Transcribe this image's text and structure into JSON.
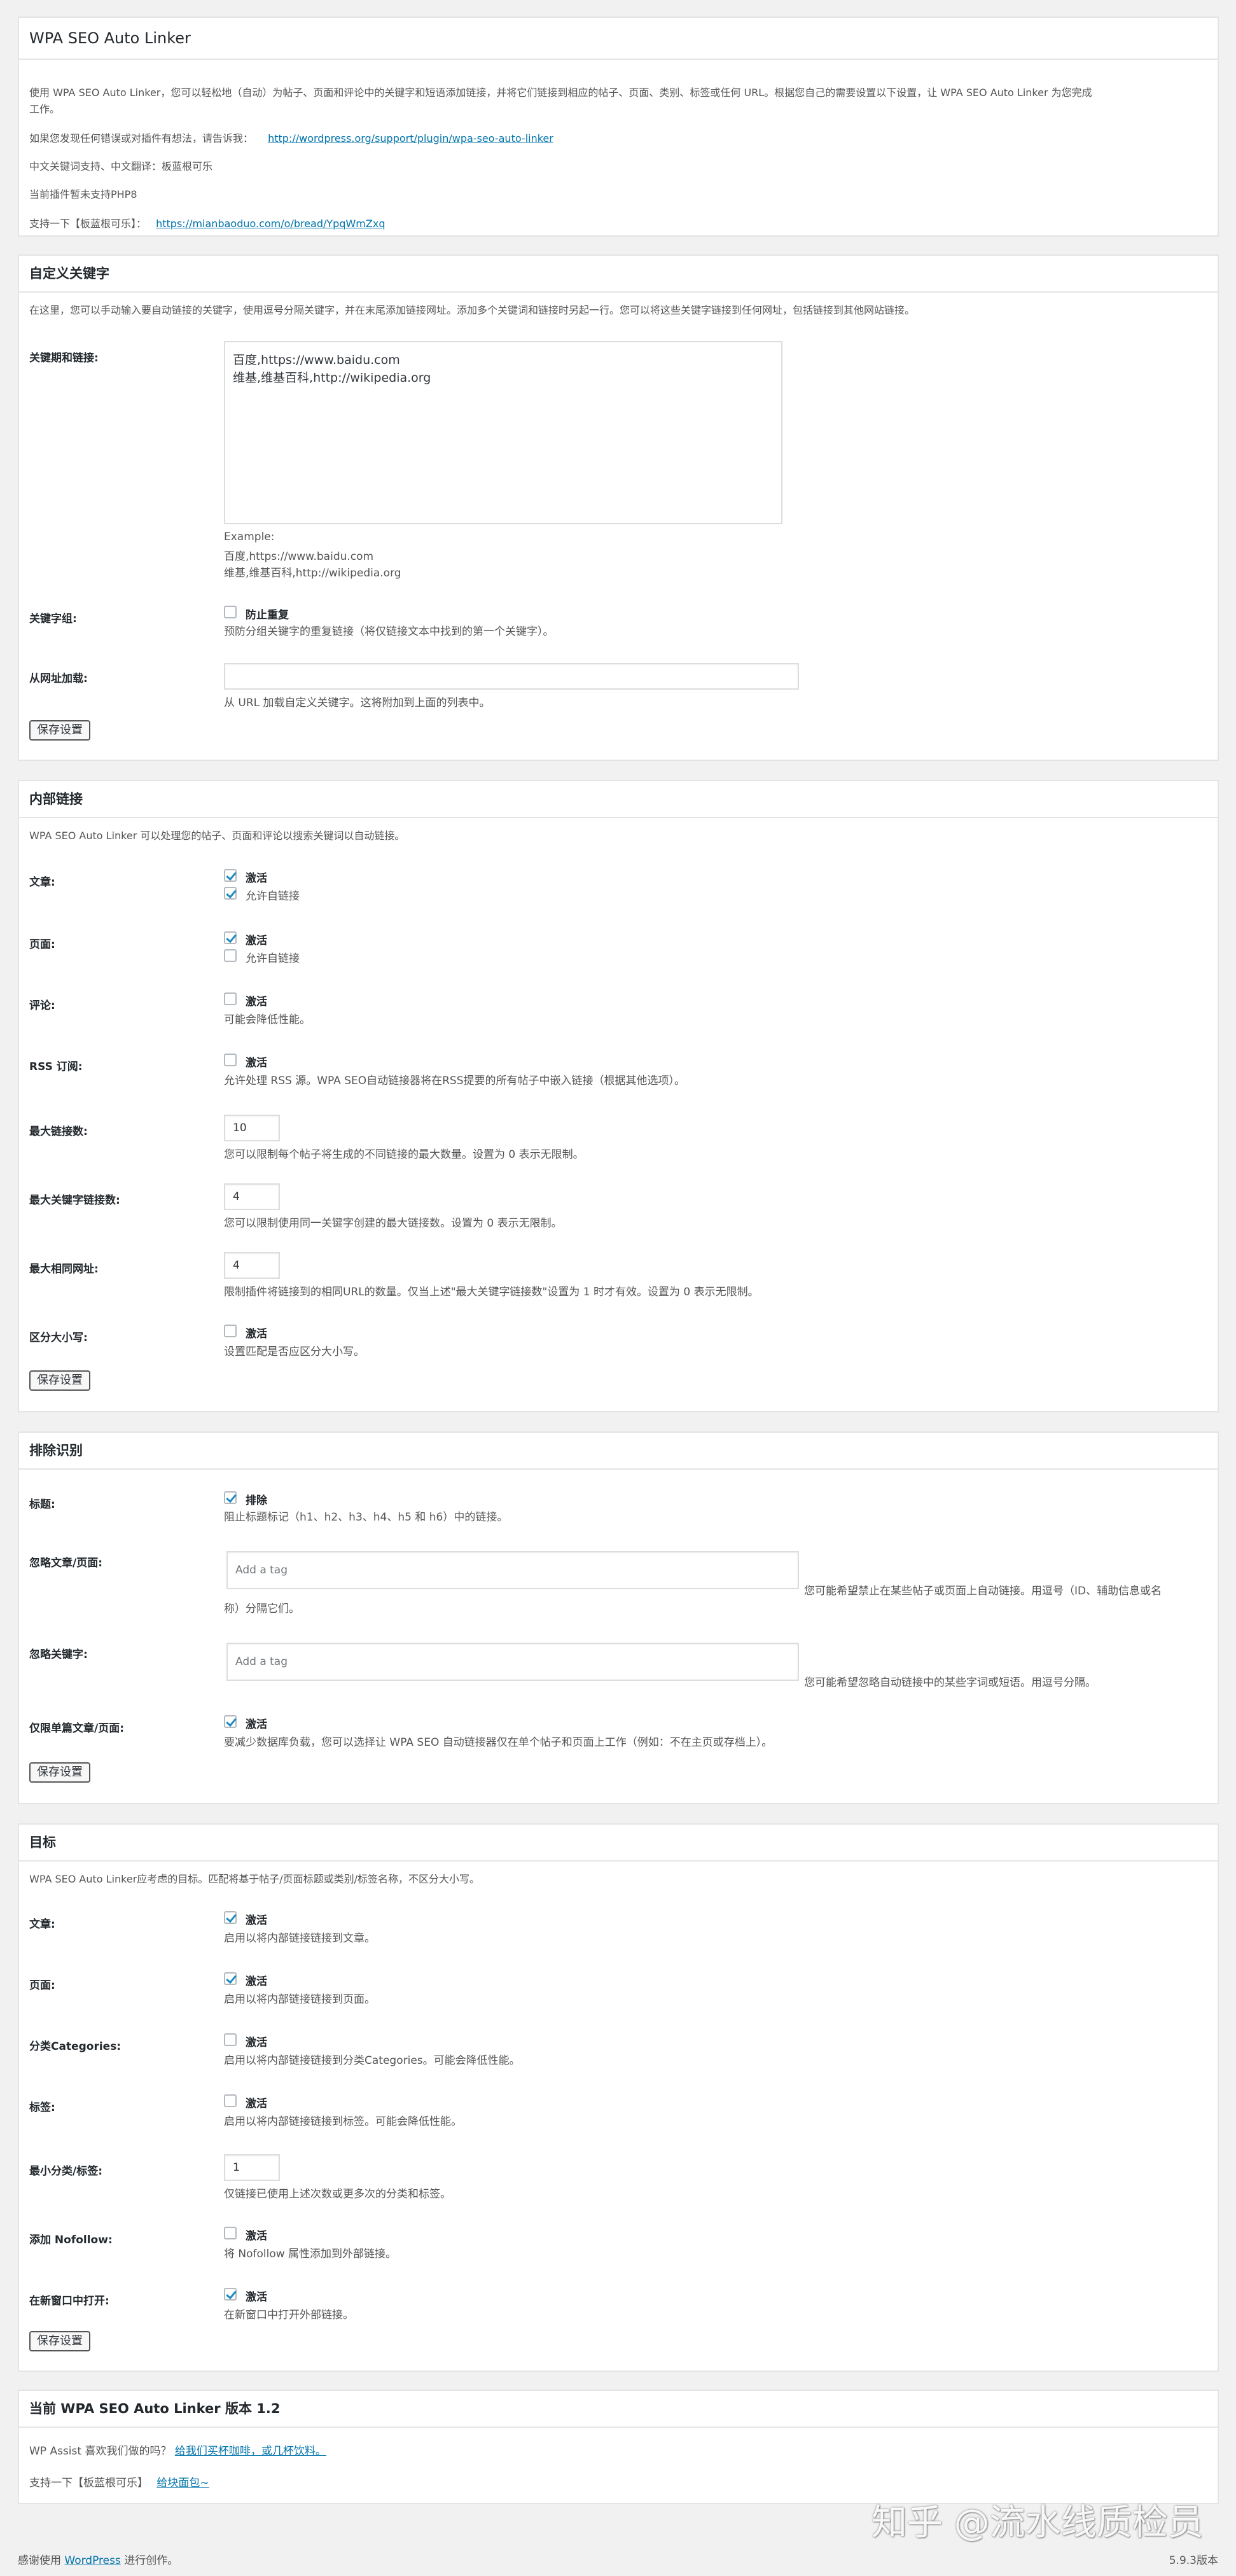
{
  "header": {
    "title": "WPA SEO Auto Linker",
    "intro_line1": "使用 WPA SEO Auto Linker，您可以轻松地（自动）为帖子、页面和评论中的关键字和短语添加链接，并将它们链接到相应的帖子、页面、类别、标签或任何 URL。根据您自己的需要设置以下设置，让 WPA SEO Auto Linker 为您完成",
    "intro_line2": "工作。",
    "report_text": "如果您发现任何错误或对插件有想法，请告诉我：",
    "report_link": "http://wordpress.org/support/plugin/wpa-seo-auto-linker",
    "chinese_support": "中文关键词支持、中文翻译：板蓝根可乐",
    "php_note": "当前插件暂未支持PHP8",
    "support_text": "支持一下【板蓝根可乐】：",
    "support_link": "https://mianbaoduo.com/o/bread/YpqWmZxq"
  },
  "custom_keywords": {
    "title": "自定义关键字",
    "desc": "在这里，您可以手动输入要自动链接的关键字，使用逗号分隔关键字，并在末尾添加链接网址。添加多个关键词和链接时另起一行。您可以将这些关键字链接到任何网址，包括链接到其他网站链接。",
    "keywords_label": "关键期和链接:",
    "keywords_value": "百度,https://www.baidu.com\n维基,维基百科,http://wikipedia.org",
    "example_title": "Example:",
    "example_line1": "百度,https://www.baidu.com",
    "example_line2": "维基,维基百科,http://wikipedia.org",
    "group_label": "关键字组:",
    "group_option": "防止重复",
    "group_desc": "预防分组关键字的重复链接（将仅链接文本中找到的第一个关键字）。",
    "url_label": "从网址加载:",
    "url_value": "",
    "url_desc": "从 URL 加载自定义关键字。这将附加到上面的列表中。",
    "save": "保存设置"
  },
  "internal_links": {
    "title": "内部链接",
    "desc": "WPA SEO Auto Linker 可以处理您的帖子、页面和评论以搜索关键词以自动链接。",
    "posts_label": "文章:",
    "posts_activate": "激活",
    "posts_self": "允许自链接",
    "pages_label": "页面:",
    "pages_activate": "激活",
    "pages_self": "允许自链接",
    "comments_label": "评论:",
    "comments_activate": "激活",
    "comments_desc": "可能会降低性能。",
    "rss_label": "RSS 订阅:",
    "rss_activate": "激活",
    "rss_desc": "允许处理 RSS 源。WPA SEO自动链接器将在RSS提要的所有帖子中嵌入链接（根据其他选项）。",
    "max_links_label": "最大链接数:",
    "max_links_value": "10",
    "max_links_desc": "您可以限制每个帖子将生成的不同链接的最大数量。设置为 0 表示无限制。",
    "max_kw_label": "最大关键字链接数:",
    "max_kw_value": "4",
    "max_kw_desc": "您可以限制使用同一关键字创建的最大链接数。设置为 0 表示无限制。",
    "max_same_label": "最大相同网址:",
    "max_same_value": "4",
    "max_same_desc": "限制插件将链接到的相同URL的数量。仅当上述\"最大关键字链接数\"设置为 1 时才有效。设置为 0 表示无限制。",
    "case_label": "区分大小写:",
    "case_activate": "激活",
    "case_desc": "设置匹配是否应区分大小写。",
    "save": "保存设置"
  },
  "exclusions": {
    "title": "排除识别",
    "headings_label": "标题:",
    "headings_option": "排除",
    "headings_desc": "阻止标题标记（h1、h2、h3、h4、h5 和 h6）中的链接。",
    "ignore_posts_label": "忽略文章/页面:",
    "ignore_posts_placeholder": "Add a tag",
    "ignore_posts_desc1": "您可能希望禁止在某些帖子或页面上自动链接。用逗号（ID、辅助信息或名",
    "ignore_posts_desc2": "称）分隔它们。",
    "ignore_kw_label": "忽略关键字:",
    "ignore_kw_placeholder": "Add a tag",
    "ignore_kw_desc": "您可能希望忽略自动链接中的某些字词或短语。用逗号分隔。",
    "single_label": "仅限单篇文章/页面:",
    "single_activate": "激活",
    "single_desc": "要减少数据库负载，您可以选择让 WPA SEO 自动链接器仅在单个帖子和页面上工作（例如：不在主页或存档上）。",
    "save": "保存设置"
  },
  "targets": {
    "title": "目标",
    "desc": "WPA SEO Auto Linker应考虑的目标。匹配将基于帖子/页面标题或类别/标签名称，不区分大小写。",
    "posts_label": "文章:",
    "posts_activate": "激活",
    "posts_desc": "启用以将内部链接链接到文章。",
    "pages_label": "页面:",
    "pages_activate": "激活",
    "pages_desc": "启用以将内部链接链接到页面。",
    "cats_label": "分类Categories:",
    "cats_activate": "激活",
    "cats_desc": "启用以将内部链接链接到分类Categories。可能会降低性能。",
    "tags_label": "标签:",
    "tags_activate": "激活",
    "tags_desc": "启用以将内部链接链接到标签。可能会降低性能。",
    "min_label": "最小分类/标签:",
    "min_value": "1",
    "min_desc": "仅链接已使用上述次数或更多次的分类和标签。",
    "nofollow_label": "添加 Nofollow:",
    "nofollow_activate": "激活",
    "nofollow_desc": "将 Nofollow 属性添加到外部链接。",
    "newwin_label": "在新窗口中打开:",
    "newwin_activate": "激活",
    "newwin_desc": "在新窗口中打开外部链接。",
    "save": "保存设置"
  },
  "version": {
    "title": "当前 WPA SEO Auto Linker 版本 1.2",
    "assist_text": "WP Assist 喜欢我们做的吗？",
    "assist_link": "给我们买杯咖啡，或几杯饮料。",
    "support_text": "支持一下【板蓝根可乐】",
    "support_link": "给块面包~"
  },
  "footer": {
    "thanks_prefix": "感谢使用",
    "thanks_link": "WordPress",
    "thanks_suffix": "进行创作。",
    "version": "5.9.3版本"
  },
  "watermark": "知乎 @流水线质检员",
  "colors": {
    "accent": "#0073aa",
    "check": "#1e8cbe",
    "bg": "#f1f1f1"
  }
}
